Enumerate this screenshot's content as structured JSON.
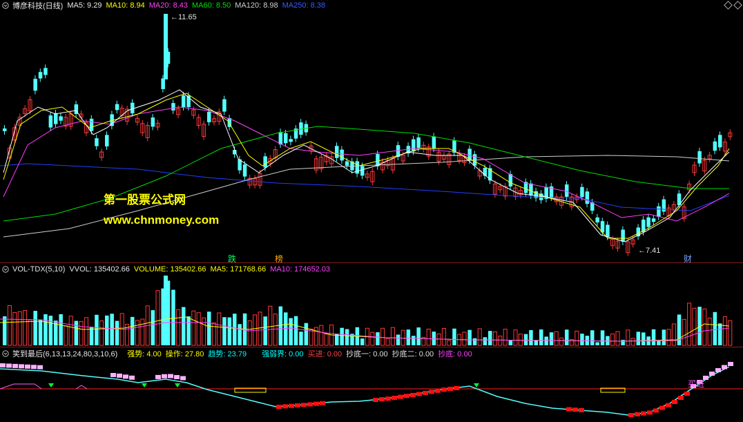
{
  "main_legend": {
    "title": "博彦科技(日线)",
    "ma5": "MA5: 9.29",
    "ma10": "MA10: 8.94",
    "ma20": "MA20: 8.43",
    "ma60": "MA60: 8.50",
    "ma120": "MA120: 8.98",
    "ma250": "MA250: 8.38"
  },
  "price_labels": {
    "high": "11.65",
    "low": "7.41"
  },
  "markers": {
    "m1": "跌",
    "m2": "榜",
    "m3": "财"
  },
  "watermark": {
    "line1": "第一股票公式网",
    "line2": "www.chnmoney.com"
  },
  "vol_legend": {
    "title": "VOL-TDX(5,10)",
    "vvol": "VVOL: 135402.66",
    "volume": "VOLUME: 135402.66",
    "ma5": "MA5: 171768.66",
    "ma10": "MA10: 174652.03"
  },
  "ind_legend": {
    "title": "笑到最后(6,13,13,24,80,3,10,6)",
    "qs": "强势: 4.00",
    "cz": "操作: 27.80",
    "qushi": "趋势: 23.79",
    "qrj": "强弱界: 0.00",
    "mj": "买进: 0.00",
    "cd1": "抄底一: 0.00",
    "cd2": "抄底二: 0.00",
    "cd": "抄底: 0.00"
  },
  "ind_text": {
    "buy": "买进"
  },
  "colors": {
    "up": "#ff3a3a",
    "down": "#54ffff",
    "ma5": "#ffffff",
    "ma10": "#ffff00",
    "ma20": "#ff40ff",
    "ma60": "#00e000",
    "ma120": "#d0d0d0",
    "ma250": "#2040ff"
  },
  "icons": {
    "settings": "gear-icon",
    "diamond": "diamond-icon"
  }
}
